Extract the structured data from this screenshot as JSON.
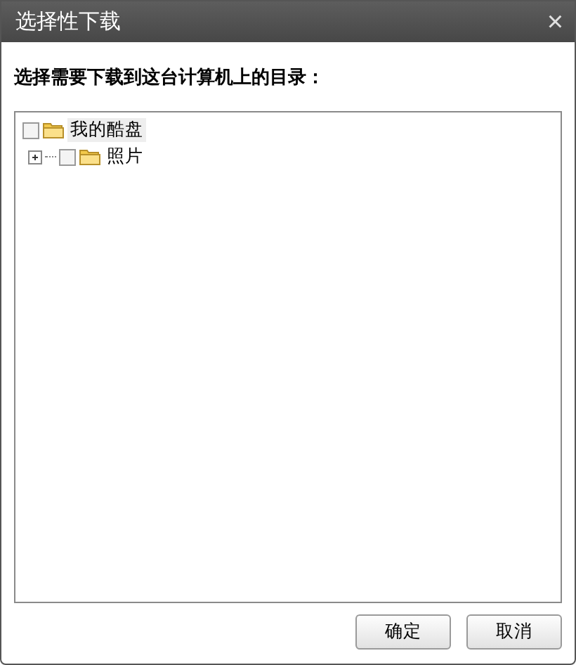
{
  "window": {
    "title": "选择性下载",
    "close": "×"
  },
  "prompt": "选择需要下载到这台计算机上的目录：",
  "tree": [
    {
      "label": "我的酷盘",
      "checked": false,
      "selected": true,
      "children": [
        {
          "label": "照片",
          "checked": false,
          "selected": false,
          "expanded": false
        }
      ]
    }
  ],
  "buttons": [
    "确定",
    "取消"
  ]
}
